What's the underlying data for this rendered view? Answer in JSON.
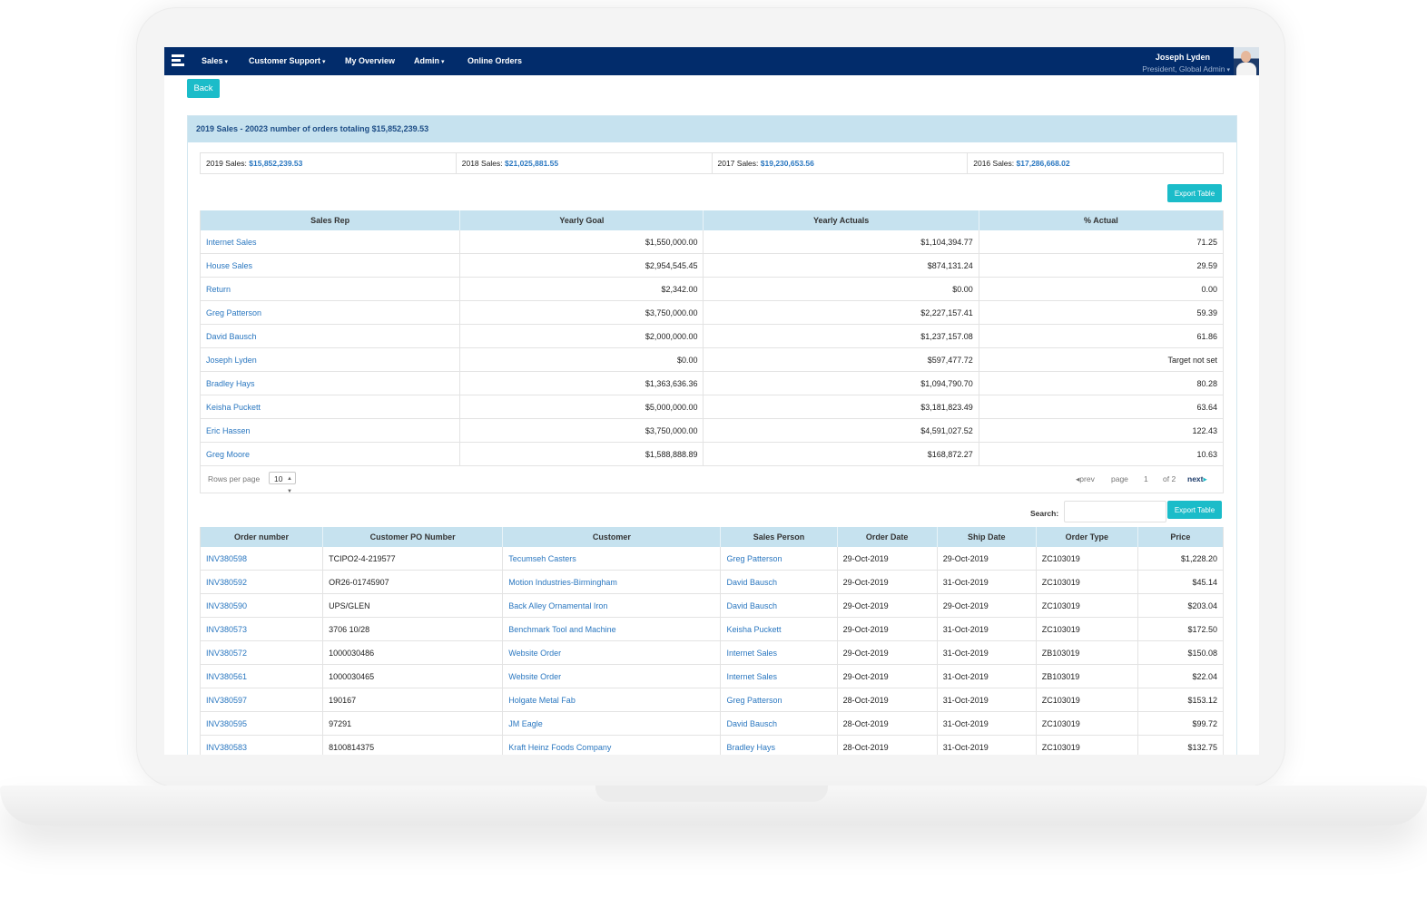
{
  "nav": {
    "items": [
      {
        "label": "Sales",
        "has_caret": true
      },
      {
        "label": "Customer Support",
        "has_caret": true
      },
      {
        "label": "My Overview",
        "has_caret": false
      },
      {
        "label": "Admin",
        "has_caret": true
      },
      {
        "label": "Online Orders",
        "has_caret": false
      }
    ],
    "user_name": "Joseph Lyden",
    "user_role": "President, Global Admin"
  },
  "back_label": "Back",
  "panel_title": "2019 Sales - 20023 number of orders totaling $15,852,239.53",
  "years": [
    {
      "label": "2019 Sales:",
      "amount": "$15,852,239.53"
    },
    {
      "label": "2018 Sales:",
      "amount": "$21,025,881.55"
    },
    {
      "label": "2017 Sales:",
      "amount": "$19,230,653.56"
    },
    {
      "label": "2016 Sales:",
      "amount": "$17,286,668.02"
    }
  ],
  "export_label": "Export Table",
  "reps_table": {
    "columns": [
      "Sales Rep",
      "Yearly Goal",
      "Yearly Actuals",
      "% Actual"
    ],
    "rows": [
      [
        "Internet Sales",
        "$1,550,000.00",
        "$1,104,394.77",
        "71.25"
      ],
      [
        "House Sales",
        "$2,954,545.45",
        "$874,131.24",
        "29.59"
      ],
      [
        "Return",
        "$2,342.00",
        "$0.00",
        "0.00"
      ],
      [
        "Greg Patterson",
        "$3,750,000.00",
        "$2,227,157.41",
        "59.39"
      ],
      [
        "David Bausch",
        "$2,000,000.00",
        "$1,237,157.08",
        "61.86"
      ],
      [
        "Joseph Lyden",
        "$0.00",
        "$597,477.72",
        "Target not set"
      ],
      [
        "Bradley Hays",
        "$1,363,636.36",
        "$1,094,790.70",
        "80.28"
      ],
      [
        "Keisha Puckett",
        "$5,000,000.00",
        "$3,181,823.49",
        "63.64"
      ],
      [
        "Eric Hassen",
        "$3,750,000.00",
        "$4,591,027.52",
        "122.43"
      ],
      [
        "Greg Moore",
        "$1,588,888.89",
        "$168,872.27",
        "10.63"
      ]
    ]
  },
  "pager": {
    "rows_per_page_label": "Rows per page",
    "rows_per_page_value": "10",
    "prev": "prev",
    "page_label": "page",
    "page": "1",
    "of": "of 2",
    "next": "next"
  },
  "search_label": "Search:",
  "orders_table": {
    "columns": [
      "Order number",
      "Customer PO Number",
      "Customer",
      "Sales Person",
      "Order Date",
      "Ship Date",
      "Order Type",
      "Price"
    ],
    "rows": [
      [
        "INV380598",
        "TCIPO2-4-219577",
        "Tecumseh Casters",
        "Greg Patterson",
        "29-Oct-2019",
        "29-Oct-2019",
        "ZC103019",
        "$1,228.20"
      ],
      [
        "INV380592",
        "OR26-01745907",
        "Motion Industries-Birmingham",
        "David Bausch",
        "29-Oct-2019",
        "31-Oct-2019",
        "ZC103019",
        "$45.14"
      ],
      [
        "INV380590",
        "UPS/GLEN",
        "Back Alley Ornamental Iron",
        "David Bausch",
        "29-Oct-2019",
        "29-Oct-2019",
        "ZC103019",
        "$203.04"
      ],
      [
        "INV380573",
        "3706 10/28",
        "Benchmark Tool and Machine",
        "Keisha Puckett",
        "29-Oct-2019",
        "31-Oct-2019",
        "ZC103019",
        "$172.50"
      ],
      [
        "INV380572",
        "1000030486",
        "Website Order",
        "Internet Sales",
        "29-Oct-2019",
        "31-Oct-2019",
        "ZB103019",
        "$150.08"
      ],
      [
        "INV380561",
        "1000030465",
        "Website Order",
        "Internet Sales",
        "29-Oct-2019",
        "31-Oct-2019",
        "ZB103019",
        "$22.04"
      ],
      [
        "INV380597",
        "190167",
        "Holgate Metal Fab",
        "Greg Patterson",
        "28-Oct-2019",
        "31-Oct-2019",
        "ZC103019",
        "$153.12"
      ],
      [
        "INV380595",
        "97291",
        "JM Eagle",
        "David Bausch",
        "28-Oct-2019",
        "31-Oct-2019",
        "ZC103019",
        "$99.72"
      ],
      [
        "INV380583",
        "8100814375",
        "Kraft Heinz Foods Company",
        "Bradley Hays",
        "28-Oct-2019",
        "31-Oct-2019",
        "ZC103019",
        "$132.75"
      ]
    ]
  },
  "colors": {
    "navbar": "#022c6b",
    "accent": "#1bbcc9",
    "link": "#2a77c0",
    "header_bg": "#c6e2ef"
  },
  "icons": {
    "menu": "hamburger-logo-icon",
    "caret": "caret-down-icon",
    "prev": "chevron-left-icon",
    "next": "chevron-right-icon"
  }
}
